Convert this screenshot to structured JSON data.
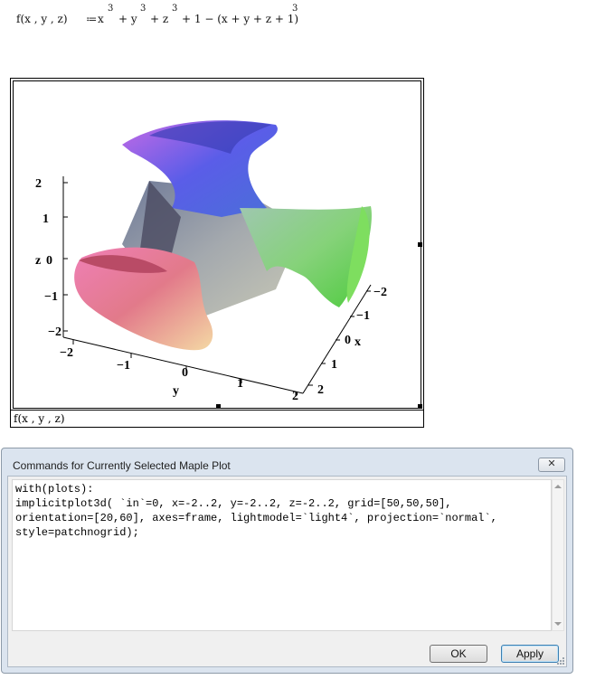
{
  "equation": {
    "lhs": "f(x , y , z)",
    "assign": "≔",
    "t1": "x",
    "e1": "3",
    "t2": "+ y",
    "e2": "3",
    "t3": "+ z",
    "e3": "3",
    "t4": "+ 1 − (x + y + z + 1)",
    "e4": "3"
  },
  "plot": {
    "caption": "f(x , y , z)",
    "axes": {
      "z_label": "z",
      "x_label": "x",
      "y_label": "y",
      "z_ticks": [
        "2",
        "1",
        "0",
        "−1",
        "−2"
      ],
      "y_ticks": [
        "−2",
        "−1",
        "0",
        "1",
        "2"
      ],
      "x_ticks": [
        "−2",
        "−1",
        "0",
        "1",
        "2"
      ]
    }
  },
  "dialog": {
    "title": "Commands for Currently Selected Maple Plot",
    "close_glyph": "✕",
    "code_lines": [
      "with(plots):",
      "implicitplot3d( `in`=0, x=-2..2, y=-2..2, z=-2..2, grid=[50,50,50],",
      "orientation=[20,60], axes=frame, lightmodel=`light4`, projection=`normal`,",
      "style=patchnogrid);"
    ],
    "ok_label": "OK",
    "apply_label": "Apply"
  },
  "colors": {
    "dialog_bg": "#dbe4ef",
    "apply_border": "#3c7fb1"
  }
}
